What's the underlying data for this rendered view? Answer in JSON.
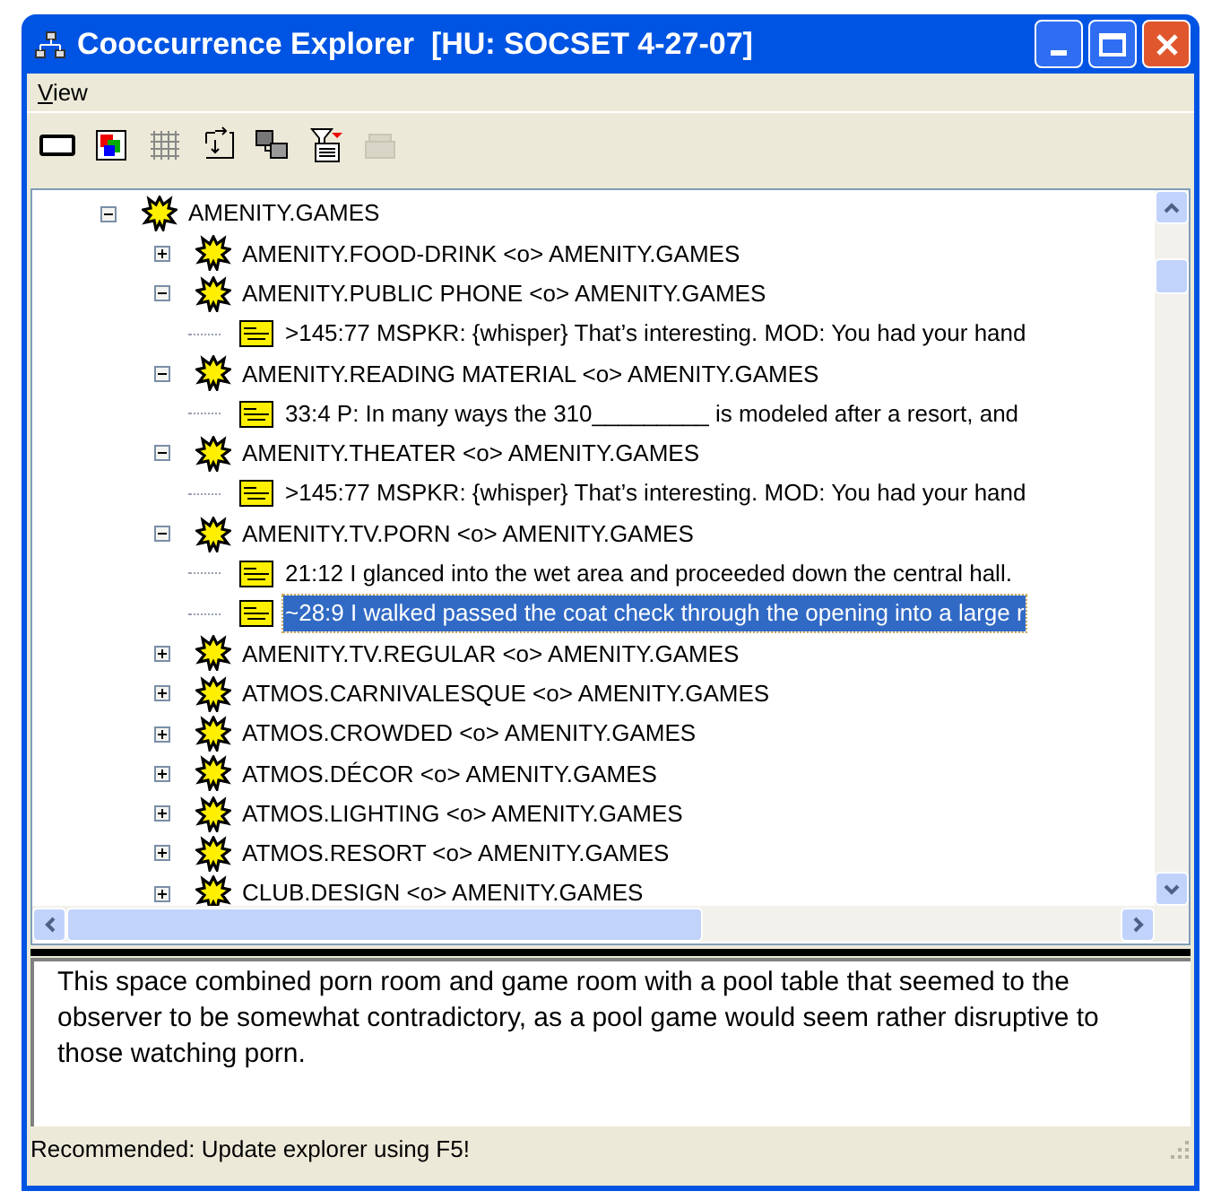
{
  "window": {
    "title": "Cooccurrence Explorer  [HU: SOCSET 4-27-07]"
  },
  "menu": [
    {
      "label": "View"
    }
  ],
  "toolbar": [
    {
      "kind": "frame",
      "disabled": false
    },
    {
      "kind": "palette",
      "disabled": false
    },
    {
      "kind": "grid",
      "disabled": false
    },
    {
      "kind": "import",
      "disabled": false
    },
    {
      "kind": "windows",
      "disabled": false
    },
    {
      "kind": "filter",
      "disabled": false
    },
    {
      "kind": "stack",
      "disabled": true
    }
  ],
  "tree": {
    "label": "AMENITY.GAMES",
    "expanded": true,
    "selected": false,
    "children": [
      {
        "label": "AMENITY.FOOD-DRINK <o> AMENITY.GAMES",
        "expanded": false,
        "selected": false
      },
      {
        "label": "AMENITY.PUBLIC PHONE <o> AMENITY.GAMES",
        "expanded": true,
        "selected": false,
        "children": [
          {
            "label": ">145:77 MSPKR: {whisper} That’s interesting. MOD: You had your hand",
            "selected": false
          }
        ]
      },
      {
        "label": "AMENITY.READING MATERIAL <o> AMENITY.GAMES",
        "expanded": true,
        "selected": false,
        "children": [
          {
            "label": "33:4 P: In many ways the 310_________ is modeled after a resort, and",
            "selected": false
          }
        ]
      },
      {
        "label": "AMENITY.THEATER <o> AMENITY.GAMES",
        "expanded": true,
        "selected": false,
        "children": [
          {
            "label": ">145:77 MSPKR: {whisper} That’s interesting. MOD: You had your hand",
            "selected": false
          }
        ]
      },
      {
        "label": "AMENITY.TV.PORN <o> AMENITY.GAMES",
        "expanded": true,
        "selected": false,
        "children": [
          {
            "label": "21:12 I glanced into the wet area and proceeded down the central hall.",
            "selected": false
          },
          {
            "label": "~28:9 I walked passed the coat check through the opening into a large r",
            "selected": true
          }
        ]
      },
      {
        "label": "AMENITY.TV.REGULAR <o> AMENITY.GAMES",
        "expanded": false,
        "selected": false
      },
      {
        "label": "ATMOS.CARNIVALESQUE <o> AMENITY.GAMES",
        "expanded": false,
        "selected": false
      },
      {
        "label": "ATMOS.CROWDED <o> AMENITY.GAMES",
        "expanded": false,
        "selected": false
      },
      {
        "label": "ATMOS.DÉCOR <o> AMENITY.GAMES",
        "expanded": false,
        "selected": false
      },
      {
        "label": "ATMOS.LIGHTING <o> AMENITY.GAMES",
        "expanded": false,
        "selected": false
      },
      {
        "label": "ATMOS.RESORT <o> AMENITY.GAMES",
        "expanded": false,
        "selected": false
      },
      {
        "label": "CLUB.DESIGN <o> AMENITY.GAMES",
        "expanded": false,
        "selected": false
      }
    ]
  },
  "comment": {
    "value": "This space combined porn room and game room with a pool table that seemed to the observer to be somewhat contradictory, as a pool game would seem rather disruptive to those watching porn."
  },
  "status_bar": {
    "text": "Recommended: Update explorer using F5!"
  }
}
